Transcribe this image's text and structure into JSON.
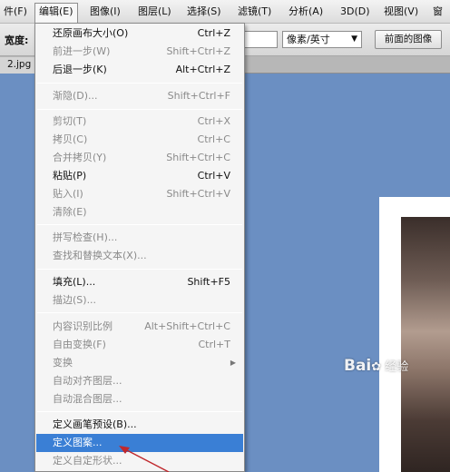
{
  "menubar": {
    "items": [
      {
        "label": "件(F)"
      },
      {
        "label": "编辑(E)"
      },
      {
        "label": "图像(I)"
      },
      {
        "label": "图层(L)"
      },
      {
        "label": "选择(S)"
      },
      {
        "label": "滤镜(T)"
      },
      {
        "label": "分析(A)"
      },
      {
        "label": "3D(D)"
      },
      {
        "label": "视图(V)"
      },
      {
        "label": "窗"
      }
    ]
  },
  "options": {
    "width_label": "宽度:",
    "unit_value": "像素/英寸",
    "front_image_label": "前面的图像"
  },
  "document": {
    "tab_label": "2.jpg"
  },
  "edit_menu": {
    "items": [
      {
        "label": "还原画布大小(O)",
        "shortcut": "Ctrl+Z"
      },
      {
        "label": "前进一步(W)",
        "shortcut": "Shift+Ctrl+Z"
      },
      {
        "label": "后退一步(K)",
        "shortcut": "Alt+Ctrl+Z"
      },
      {
        "label": "渐隐(D)...",
        "shortcut": "Shift+Ctrl+F"
      },
      {
        "label": "剪切(T)",
        "shortcut": "Ctrl+X"
      },
      {
        "label": "拷贝(C)",
        "shortcut": "Ctrl+C"
      },
      {
        "label": "合并拷贝(Y)",
        "shortcut": "Shift+Ctrl+C"
      },
      {
        "label": "粘贴(P)",
        "shortcut": "Ctrl+V"
      },
      {
        "label": "贴入(I)",
        "shortcut": "Shift+Ctrl+V"
      },
      {
        "label": "清除(E)",
        "shortcut": ""
      },
      {
        "label": "拼写检查(H)...",
        "shortcut": ""
      },
      {
        "label": "查找和替换文本(X)...",
        "shortcut": ""
      },
      {
        "label": "填充(L)...",
        "shortcut": "Shift+F5"
      },
      {
        "label": "描边(S)...",
        "shortcut": ""
      },
      {
        "label": "内容识别比例",
        "shortcut": "Alt+Shift+Ctrl+C"
      },
      {
        "label": "自由变换(F)",
        "shortcut": "Ctrl+T"
      },
      {
        "label": "变换",
        "shortcut": ""
      },
      {
        "label": "自动对齐图层...",
        "shortcut": ""
      },
      {
        "label": "自动混合图层...",
        "shortcut": ""
      },
      {
        "label": "定义画笔预设(B)...",
        "shortcut": ""
      },
      {
        "label": "定义图案...",
        "shortcut": ""
      },
      {
        "label": "定义自定形状...",
        "shortcut": ""
      }
    ]
  },
  "watermark": {
    "text": "Bai",
    "text2": "经验"
  }
}
